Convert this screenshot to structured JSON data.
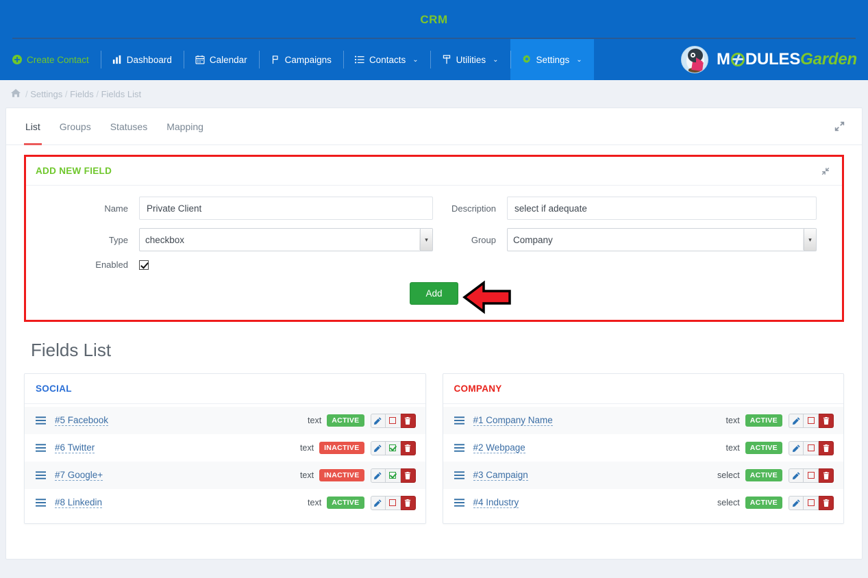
{
  "header": {
    "brand_title": "CRM"
  },
  "nav": {
    "items": [
      {
        "label": "Create Contact",
        "icon": "plus-circle-icon",
        "style": "create",
        "caret": false
      },
      {
        "label": "Dashboard",
        "icon": "bar-chart-icon",
        "style": "normal",
        "caret": false
      },
      {
        "label": "Calendar",
        "icon": "calendar-icon",
        "style": "normal",
        "caret": false
      },
      {
        "label": "Campaigns",
        "icon": "flag-icon",
        "style": "normal",
        "caret": false
      },
      {
        "label": "Contacts",
        "icon": "list-icon",
        "style": "normal",
        "caret": true
      },
      {
        "label": "Utilities",
        "icon": "signpost-icon",
        "style": "normal",
        "caret": true
      },
      {
        "label": "Settings",
        "icon": "gear-icon",
        "style": "active",
        "caret": true
      }
    ],
    "caret_glyph": "⌄"
  },
  "logo": {
    "text_main": "M",
    "text_main2": "DULES",
    "text_accent": "Garden"
  },
  "breadcrumb": {
    "home_icon": "home-icon",
    "items": [
      "Settings",
      "Fields",
      "Fields List"
    ],
    "separator": "/"
  },
  "tabs": [
    {
      "label": "List",
      "active": true
    },
    {
      "label": "Groups",
      "active": false
    },
    {
      "label": "Statuses",
      "active": false
    },
    {
      "label": "Mapping",
      "active": false
    }
  ],
  "panel": {
    "title": "ADD NEW FIELD",
    "fields": {
      "name_label": "Name",
      "name_value": "Private Client",
      "description_label": "Description",
      "description_value": "select if adequate",
      "type_label": "Type",
      "type_value": "checkbox",
      "group_label": "Group",
      "group_value": "Company",
      "enabled_label": "Enabled",
      "enabled_checked": true
    },
    "submit_label": "Add"
  },
  "fields_list": {
    "title": "Fields List",
    "groups": [
      {
        "name": "SOCIAL",
        "color": "#2b6fd6",
        "rows": [
          {
            "label": "#5 Facebook",
            "type": "text",
            "status": "ACTIVE",
            "status_kind": "active",
            "toggle": "square-outline-red-icon"
          },
          {
            "label": "#6 Twitter",
            "type": "text",
            "status": "INACTIVE",
            "status_kind": "inactive",
            "toggle": "square-checked-green-icon"
          },
          {
            "label": "#7 Google+",
            "type": "text",
            "status": "INACTIVE",
            "status_kind": "inactive",
            "toggle": "square-checked-green-icon"
          },
          {
            "label": "#8 Linkedin",
            "type": "text",
            "status": "ACTIVE",
            "status_kind": "active",
            "toggle": "square-outline-red-icon"
          }
        ]
      },
      {
        "name": "COMPANY",
        "color": "#e8231c",
        "rows": [
          {
            "label": "#1 Company Name",
            "type": "text",
            "status": "ACTIVE",
            "status_kind": "active",
            "toggle": "square-outline-red-icon"
          },
          {
            "label": "#2 Webpage",
            "type": "text",
            "status": "ACTIVE",
            "status_kind": "active",
            "toggle": "square-outline-red-icon"
          },
          {
            "label": "#3 Campaign",
            "type": "select",
            "status": "ACTIVE",
            "status_kind": "active",
            "toggle": "square-outline-red-icon"
          },
          {
            "label": "#4 Industry",
            "type": "select",
            "status": "ACTIVE",
            "status_kind": "active",
            "toggle": "square-outline-red-icon"
          }
        ]
      }
    ]
  },
  "colors": {
    "topbar_blue": "#0b69c7",
    "nav_active_blue": "#1484e6",
    "brand_green": "#7ec62c",
    "annotation_red": "#ef1b1b",
    "tab_underline": "#eb5a5a",
    "add_button_green": "#2aa33f"
  }
}
